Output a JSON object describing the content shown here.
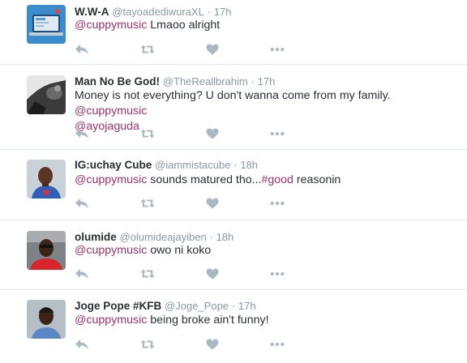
{
  "colors": {
    "accent": "#a0326b",
    "muted": "#8899a6",
    "icon": "#aab8c2",
    "divider": "#e1e8ed"
  },
  "tweets": [
    {
      "name": "W.W-A",
      "handle": "@tayoadediwuraXL",
      "dot": "·",
      "time": "17h",
      "mention": "@cuppymusic",
      "text": " Lmaoo alright",
      "avatar": "laptop-avatar"
    },
    {
      "name": "Man No Be God!",
      "handle": "@TheReallbrahim",
      "dot": "·",
      "time": "17h",
      "text_line1": "Money is not everything? U don't wanna come from my family.  ",
      "mention": "@cuppymusic",
      "mention2": "@ayojaguda",
      "avatar": "bw-photo-avatar"
    },
    {
      "name": "IG:uchay Cube",
      "handle": "@iammistacube",
      "dot": "·",
      "time": "18h",
      "mention": "@cuppymusic",
      "text": " sounds matured tho...",
      "hashtag": "#good",
      "text2": " reasonin",
      "avatar": "person-avatar"
    },
    {
      "name": "olumide",
      "handle": "@olumideajayiben",
      "dot": "·",
      "time": "18h",
      "mention": "@cuppymusic",
      "text": "  owo ni koko",
      "avatar": "car-selfie-avatar"
    },
    {
      "name": "Joge Pope #KFB",
      "handle": "@Joge_Pope",
      "dot": "·",
      "time": "17h",
      "mention": "@cuppymusic",
      "text": " being broke ain't funny!",
      "avatar": "portrait-avatar"
    }
  ],
  "action_icons": [
    "reply-icon",
    "retweet-icon",
    "like-icon",
    "more-icon"
  ]
}
